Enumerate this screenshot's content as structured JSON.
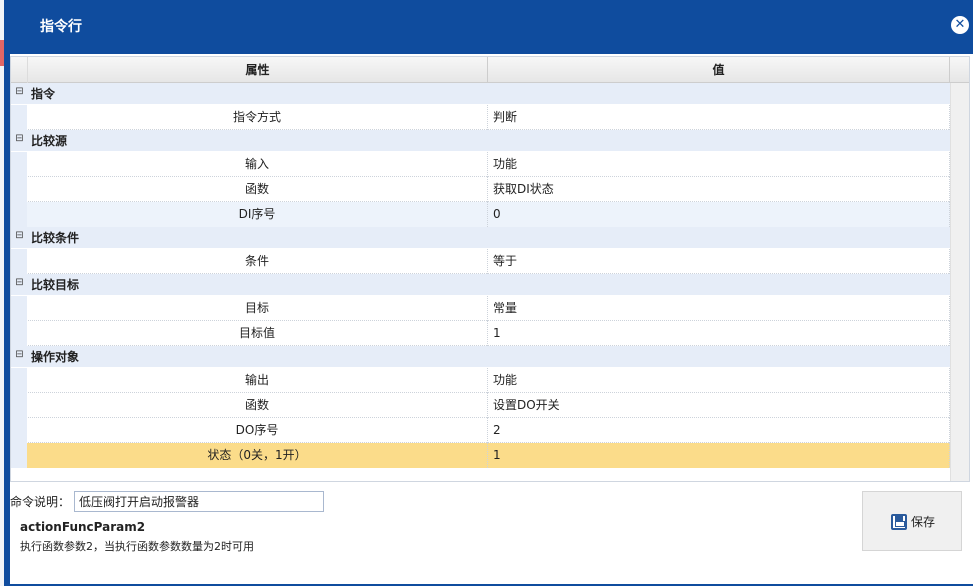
{
  "dialog": {
    "title": "指令行",
    "close_icon": "close-circle-icon"
  },
  "grid": {
    "headers": {
      "property": "属性",
      "value": "值"
    },
    "groups": [
      {
        "label": "指令",
        "rows": [
          {
            "name": "指令方式",
            "value": "判断"
          }
        ]
      },
      {
        "label": "比较源",
        "rows": [
          {
            "name": "输入",
            "value": "功能"
          },
          {
            "name": "函数",
            "value": "获取DI状态"
          },
          {
            "name": "DI序号",
            "value": "0"
          }
        ]
      },
      {
        "label": "比较条件",
        "rows": [
          {
            "name": "条件",
            "value": "等于"
          }
        ]
      },
      {
        "label": "比较目标",
        "rows": [
          {
            "name": "目标",
            "value": "常量"
          },
          {
            "name": "目标值",
            "value": "1"
          }
        ]
      },
      {
        "label": "操作对象",
        "rows": [
          {
            "name": "输出",
            "value": "功能"
          },
          {
            "name": "函数",
            "value": "设置DO开关"
          },
          {
            "name": "DO序号",
            "value": "2"
          },
          {
            "name": "状态（0关，1开）",
            "value": "1"
          }
        ]
      }
    ],
    "group_toggle_symbol": "⊟"
  },
  "footer": {
    "description_label": "命令说明：",
    "description_value": "低压阀打开启动报警器",
    "param_name": "actionFuncParam2",
    "param_desc": "执行函数参数2，当执行函数参数数量为2时可用",
    "save_label": "保存",
    "save_icon": "save-disk-icon"
  },
  "colors": {
    "titlebar": "#0f4c9e",
    "group_bg": "#e6edf8",
    "selected_row": "#fbdc8a",
    "alt_row": "#edf3fb"
  }
}
